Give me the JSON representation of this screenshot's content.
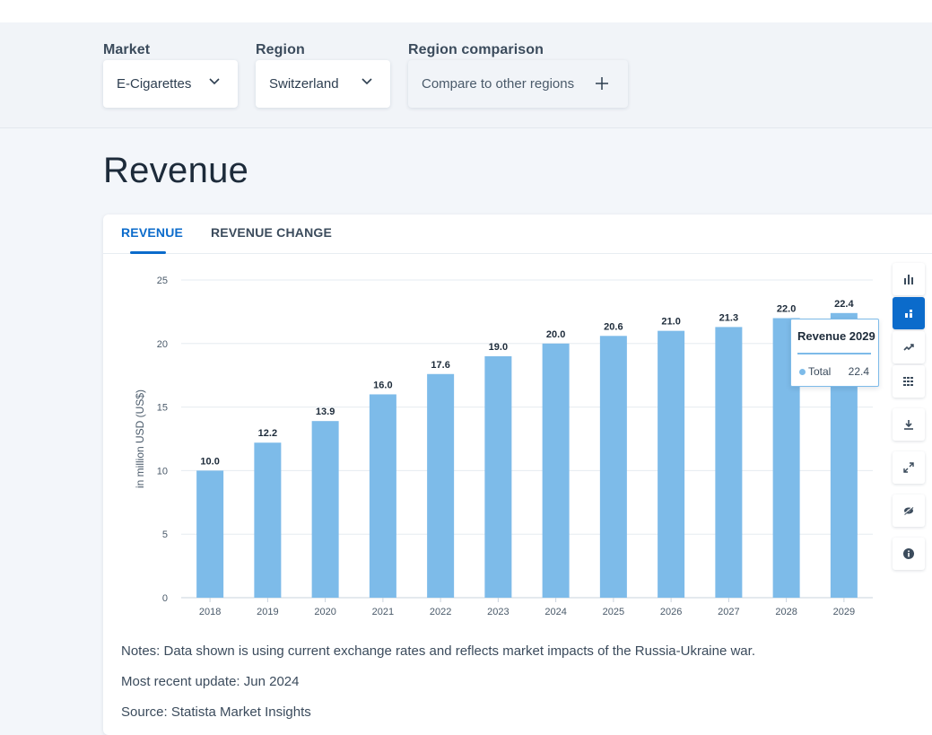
{
  "filters": {
    "market": {
      "label": "Market",
      "value": "E-Cigarettes"
    },
    "region": {
      "label": "Region",
      "value": "Switzerland"
    },
    "comparison": {
      "label": "Region comparison",
      "value": "Compare to other regions"
    }
  },
  "page_title": "Revenue",
  "tabs": [
    {
      "label": "REVENUE",
      "active": true
    },
    {
      "label": "REVENUE CHANGE",
      "active": false
    }
  ],
  "tools": [
    {
      "icon": "bar-chart-icon",
      "active": false
    },
    {
      "icon": "stacked-bar-icon",
      "active": true
    },
    {
      "icon": "trend-line-icon",
      "active": false
    },
    {
      "icon": "table-icon",
      "active": false
    },
    {
      "icon": "download-icon",
      "active": false
    },
    {
      "icon": "fullscreen-icon",
      "active": false
    },
    {
      "icon": "hide-icon",
      "active": false
    },
    {
      "icon": "info-icon",
      "active": false
    }
  ],
  "chart_data": {
    "type": "bar",
    "categories": [
      "2018",
      "2019",
      "2020",
      "2021",
      "2022",
      "2023",
      "2024",
      "2025",
      "2026",
      "2027",
      "2028",
      "2029"
    ],
    "series": [
      {
        "name": "Total",
        "values": [
          10.0,
          12.2,
          13.9,
          16.0,
          17.6,
          19.0,
          20.0,
          20.6,
          21.0,
          21.3,
          22.0,
          22.4
        ]
      }
    ],
    "ylabel": "in million USD (US$)",
    "ylim": [
      0,
      25
    ],
    "yticks": [
      0,
      5,
      10,
      15,
      20,
      25
    ],
    "grid": true,
    "bar_color": "#7dbbe9",
    "data_labels": [
      "10.0",
      "12.2",
      "13.9",
      "16.0",
      "17.6",
      "19.0",
      "20.0",
      "20.6",
      "21.0",
      "21.3",
      "22.0",
      "22.4"
    ]
  },
  "tooltip": {
    "title": "Revenue 2029",
    "series": "Total",
    "value": "22.4"
  },
  "notes": [
    "Notes: Data shown is using current exchange rates and reflects market impacts of the Russia-Ukraine war.",
    "Most recent update: Jun 2024",
    "Source: Statista Market Insights"
  ]
}
